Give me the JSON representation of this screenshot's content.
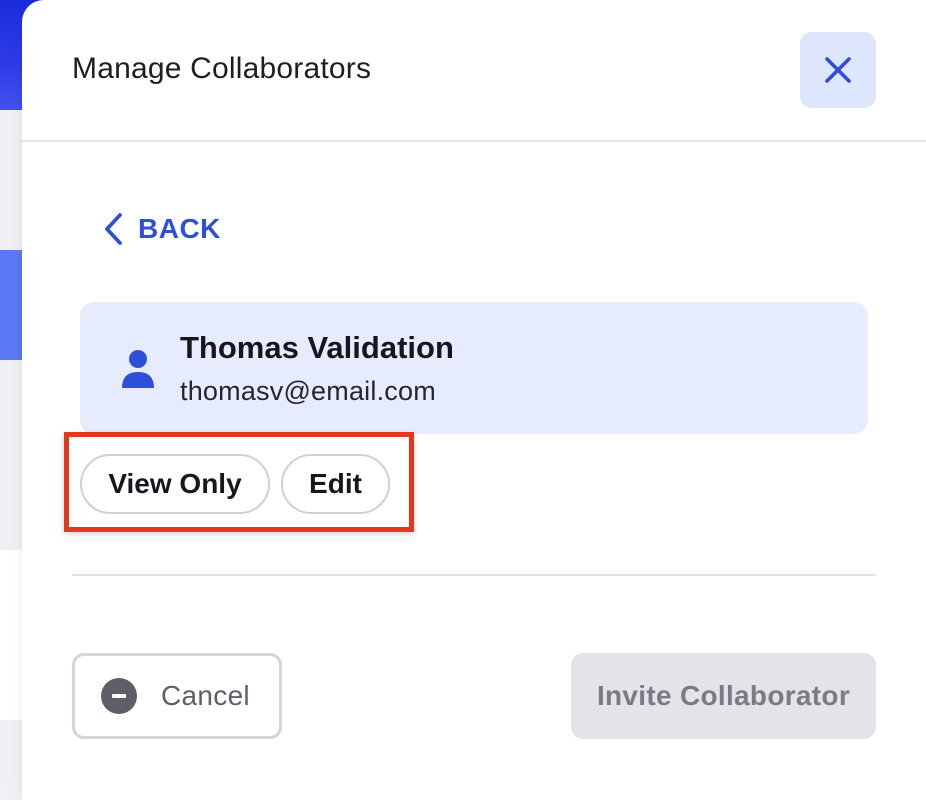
{
  "modal": {
    "title": "Manage Collaborators",
    "close_icon": "close-icon"
  },
  "back": {
    "label": "BACK",
    "icon": "chevron-left-icon"
  },
  "collaborator": {
    "name": "Thomas Validation",
    "email": "thomasv@email.com",
    "icon": "user-icon"
  },
  "permissions": {
    "options": [
      "View Only",
      "Edit"
    ]
  },
  "footer": {
    "cancel_label": "Cancel",
    "cancel_icon": "minus-circle-icon",
    "invite_label": "Invite Collaborator",
    "invite_disabled": true
  },
  "colors": {
    "accent": "#2e4fd9",
    "card_bg": "#e6ecfd",
    "highlight": "#e5361e",
    "disabled_bg": "#e3e3e8"
  }
}
